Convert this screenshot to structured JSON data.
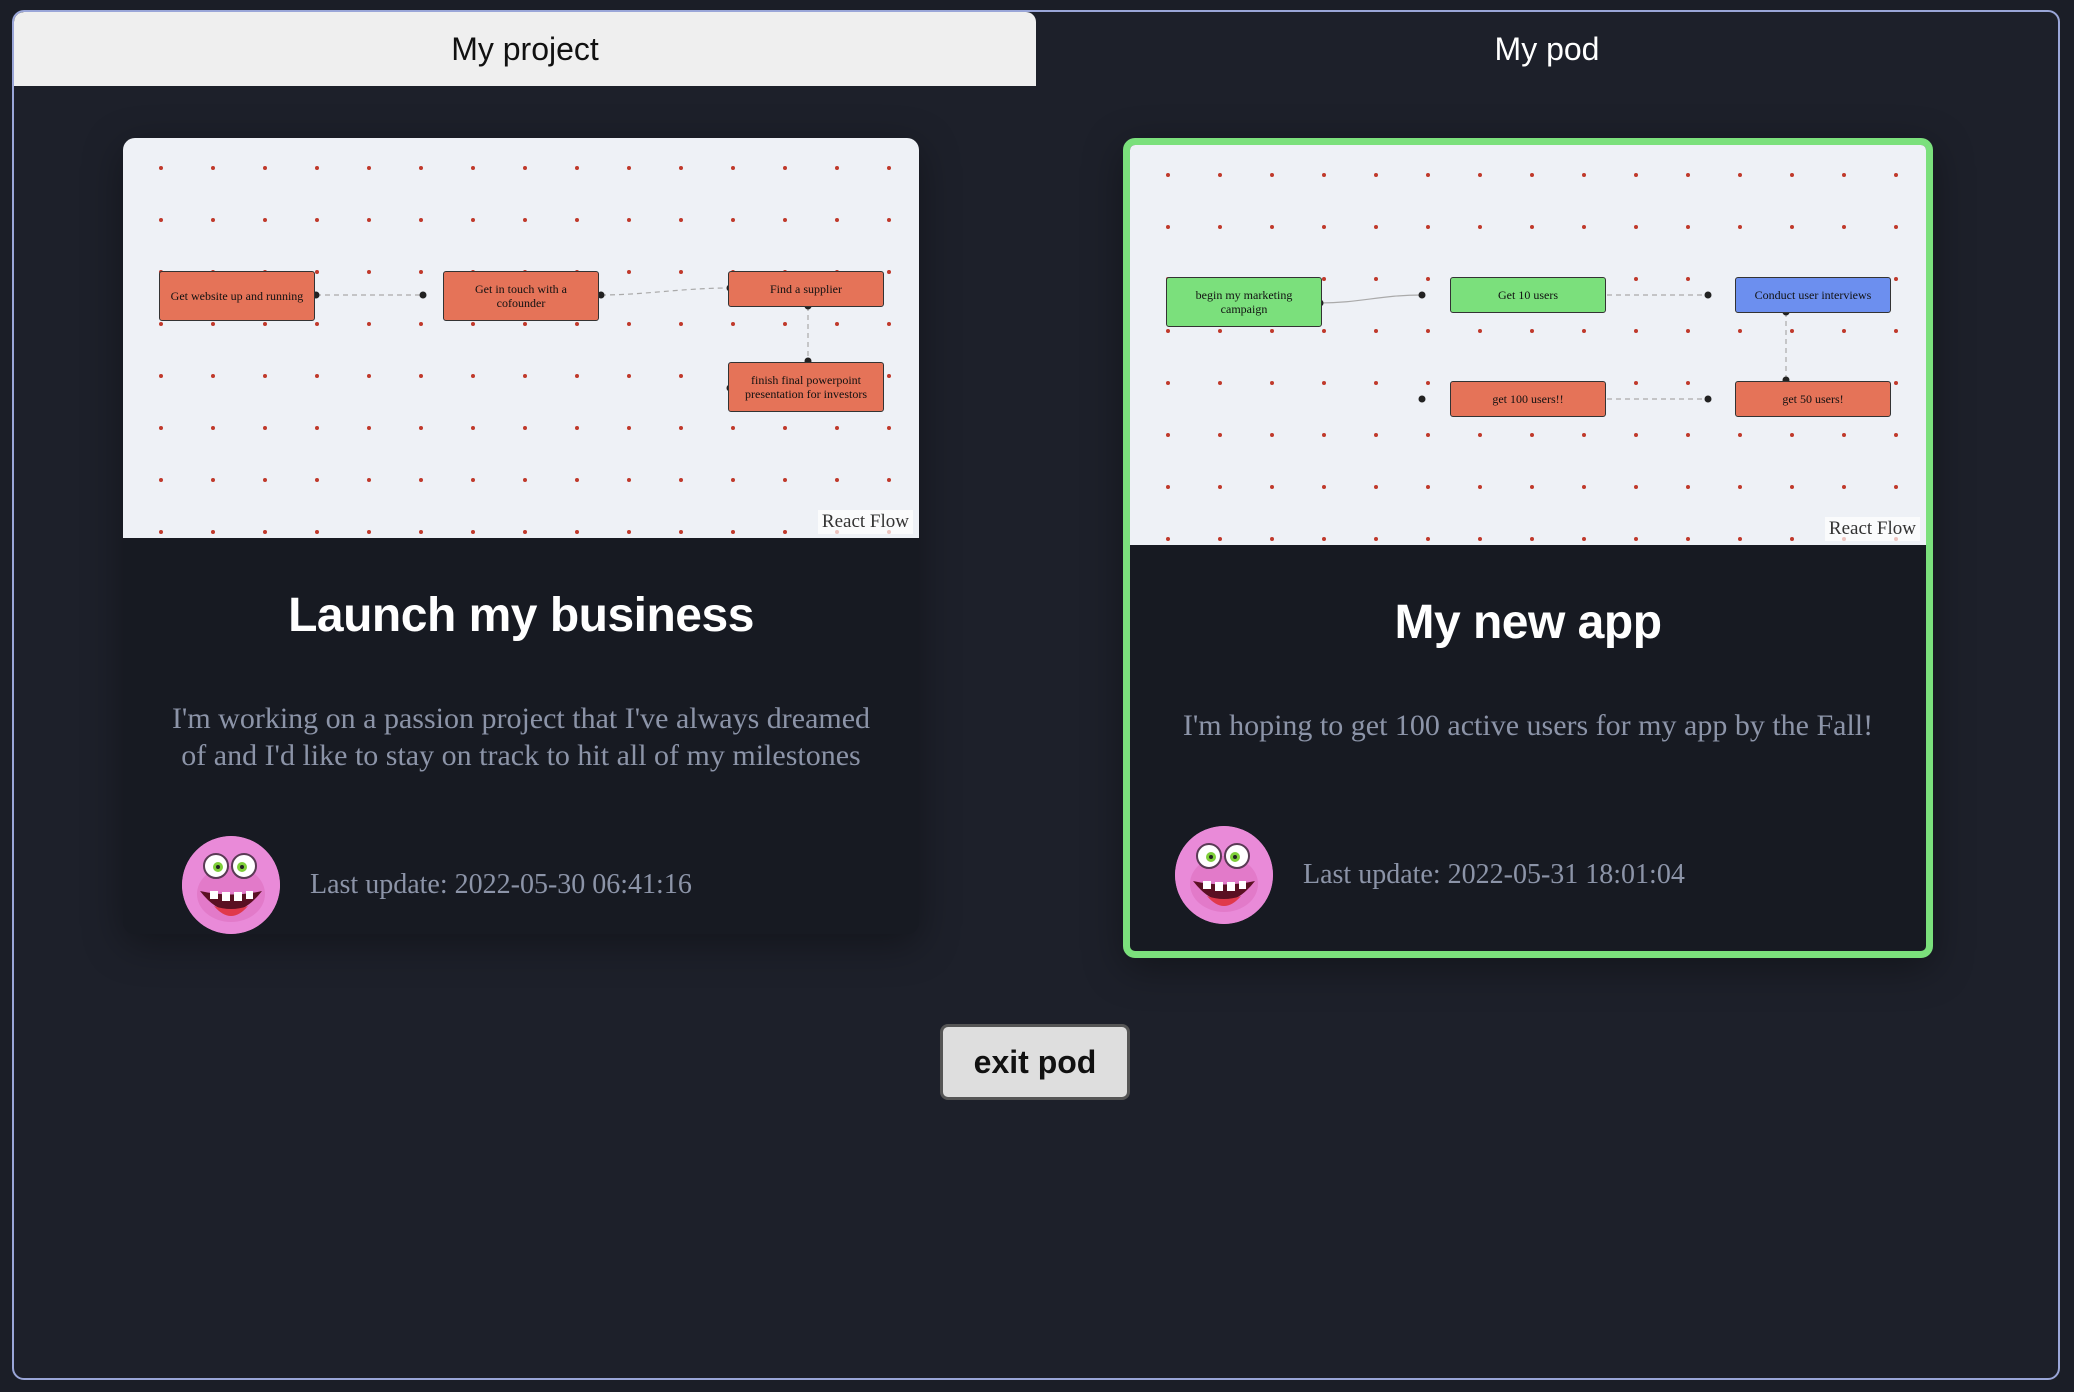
{
  "tabs": [
    {
      "label": "My project"
    },
    {
      "label": "My pod"
    }
  ],
  "cards": [
    {
      "title": "Launch my business",
      "description": "I'm working on a passion project that I've always dreamed of and I'd like to stay on track to hit all of my milestones",
      "last_update": "Last update: 2022-05-30 06:41:16",
      "flow_attribution": "React Flow",
      "nodes": [
        {
          "label": "Get website up and running",
          "color": "#e57358"
        },
        {
          "label": "Get in touch with a cofounder",
          "color": "#e57358"
        },
        {
          "label": "Find a supplier",
          "color": "#e57358"
        },
        {
          "label": "finish final powerpoint presentation for investors",
          "color": "#e57358"
        }
      ]
    },
    {
      "title": "My new app",
      "description": "I'm hoping to get 100 active users for my app by the Fall!",
      "last_update": "Last update: 2022-05-31 18:01:04",
      "flow_attribution": "React Flow",
      "selected": true,
      "nodes": [
        {
          "label": "begin my marketing campaign",
          "color": "#7be07c"
        },
        {
          "label": "Get 10 users",
          "color": "#7be07c"
        },
        {
          "label": "Conduct user interviews",
          "color": "#6c8fef"
        },
        {
          "label": "get 100 users!!",
          "color": "#e57358"
        },
        {
          "label": "get 50 users!",
          "color": "#e57358"
        }
      ]
    }
  ],
  "exit_button": {
    "label": "exit pod"
  },
  "colors": {
    "background": "#1d202a",
    "card": "#171a22",
    "selected_border": "#7be07c",
    "node_red": "#e57358",
    "node_green": "#7be07c",
    "node_blue": "#6c8fef"
  }
}
